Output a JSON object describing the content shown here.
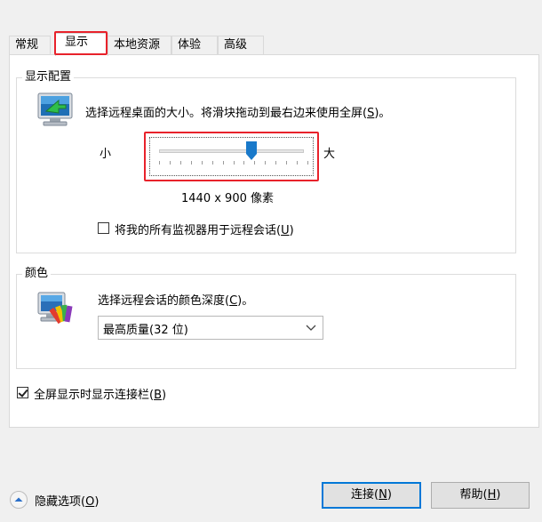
{
  "tabs": [
    {
      "label": "常规",
      "active": false
    },
    {
      "label": "显示",
      "active": true
    },
    {
      "label": "本地资源",
      "active": false
    },
    {
      "label": "体验",
      "active": false
    },
    {
      "label": "高级",
      "active": false
    }
  ],
  "display": {
    "group_title": "显示配置",
    "description_pre": "选择远程桌面的大小。将滑块拖动到最右边来使用全屏(",
    "description_key": "S",
    "description_post": ")。",
    "slider_min_label": "小",
    "slider_max_label": "大",
    "slider_fraction": 0.62,
    "resolution": "1440 x 900 像素",
    "multimon_pre": "将我的所有监视器用于远程会话(",
    "multimon_key": "U",
    "multimon_post": ")",
    "multimon_checked": false
  },
  "color": {
    "group_title": "颜色",
    "description_pre": "选择远程会话的颜色深度(",
    "description_key": "C",
    "description_post": ")。",
    "selected": "最高质量(32 位)"
  },
  "connection_bar": {
    "label_pre": "全屏显示时显示连接栏(",
    "label_key": "B",
    "label_post": ")",
    "checked": true
  },
  "footer": {
    "hide_pre": "隐藏选项(",
    "hide_key": "O",
    "hide_post": ")",
    "connect_pre": "连接(",
    "connect_key": "N",
    "connect_post": ")",
    "help_pre": "帮助(",
    "help_key": "H",
    "help_post": ")"
  },
  "colors": {
    "highlight": "#e8222b",
    "accent": "#0078d7",
    "slider_thumb": "#1979ca"
  }
}
